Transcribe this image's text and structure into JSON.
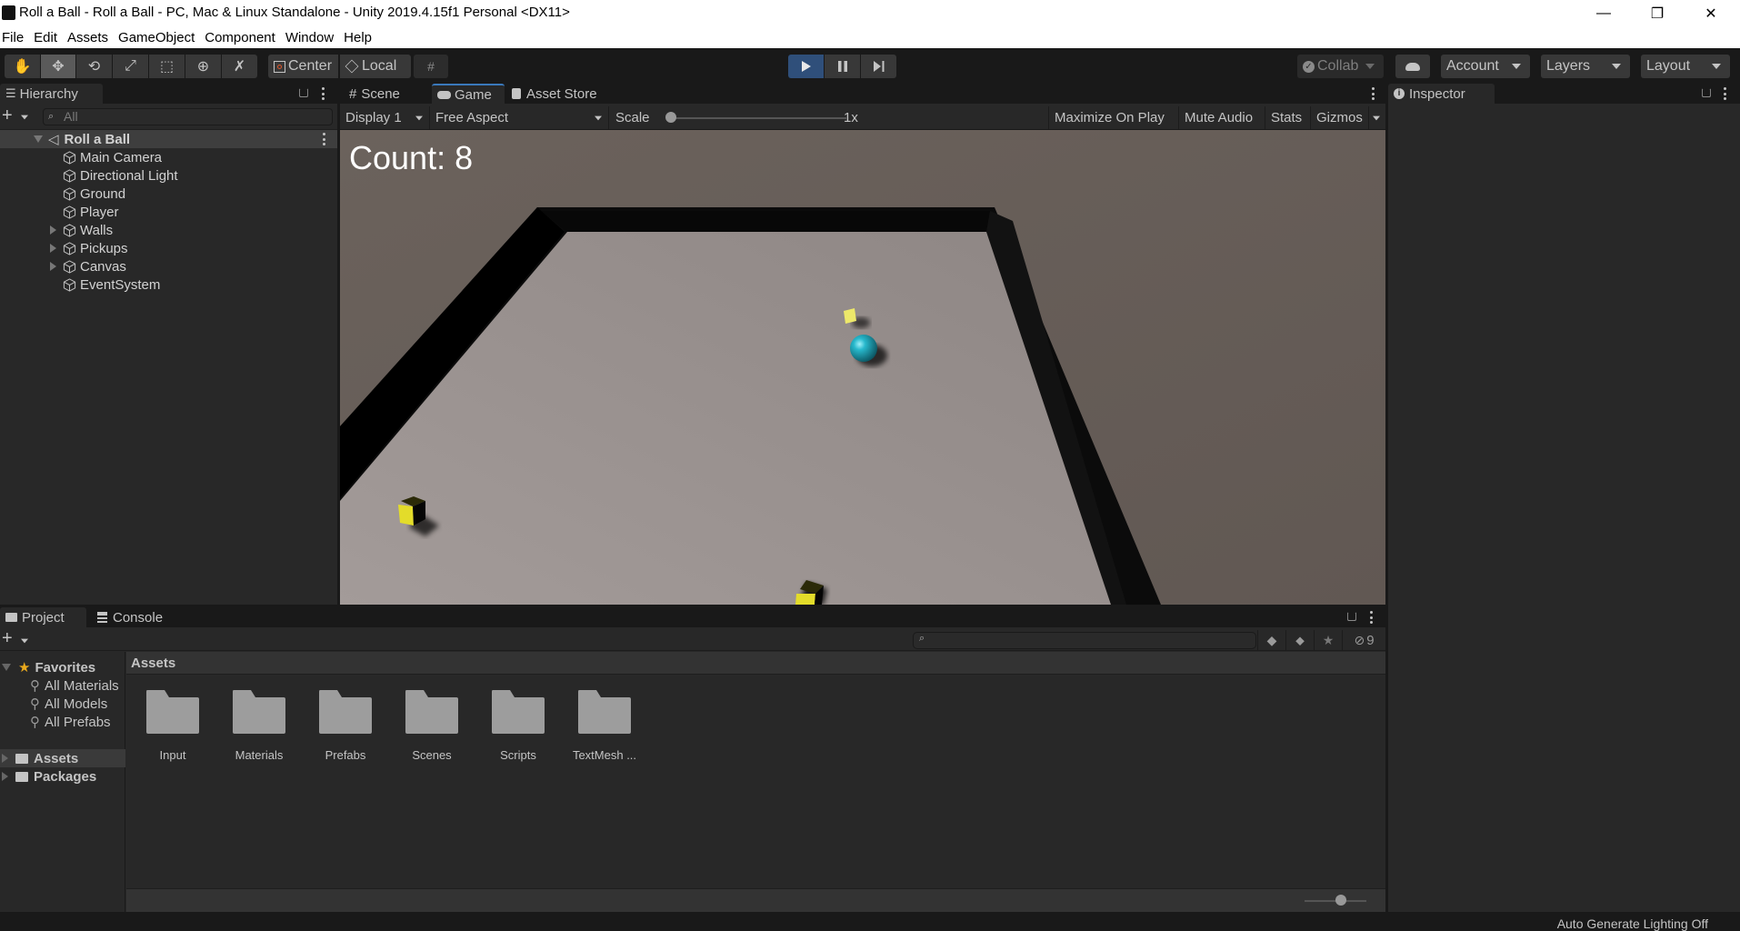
{
  "window": {
    "title": "Roll a Ball - Roll a Ball - PC, Mac & Linux Standalone - Unity 2019.4.15f1 Personal <DX11>",
    "controls": {
      "minimize": "—",
      "maximize": "❐",
      "close": "✕"
    }
  },
  "menubar": [
    "File",
    "Edit",
    "Assets",
    "GameObject",
    "Component",
    "Window",
    "Help"
  ],
  "toolbar": {
    "tools": [
      {
        "name": "hand-tool",
        "icon": "hand-icon",
        "glyph": "✋",
        "active": false
      },
      {
        "name": "move-tool",
        "icon": "move-icon",
        "glyph": "✥",
        "active": true
      },
      {
        "name": "rotate-tool",
        "icon": "rotate-icon",
        "glyph": "⟲",
        "active": false
      },
      {
        "name": "scale-tool",
        "icon": "scale-icon",
        "glyph": "⤢",
        "active": false
      },
      {
        "name": "rect-tool",
        "icon": "rect-icon",
        "glyph": "⬚",
        "active": false
      },
      {
        "name": "transform-tool",
        "icon": "transform-icon",
        "glyph": "⊕",
        "active": false
      },
      {
        "name": "custom-tool",
        "icon": "wrench-icon",
        "glyph": "✗",
        "active": false
      }
    ],
    "pivot_mode": "Center",
    "pivot_rotation": "Local",
    "collab": "Collab",
    "account": "Account",
    "layers": "Layers",
    "layout": "Layout",
    "accent": "#2f4f7a"
  },
  "hierarchy": {
    "tab": "Hierarchy",
    "search_placeholder": "All",
    "scene": "Roll a Ball",
    "items": [
      {
        "label": "Main Camera",
        "expandable": false
      },
      {
        "label": "Directional Light",
        "expandable": false
      },
      {
        "label": "Ground",
        "expandable": false
      },
      {
        "label": "Player",
        "expandable": false
      },
      {
        "label": "Walls",
        "expandable": true
      },
      {
        "label": "Pickups",
        "expandable": true
      },
      {
        "label": "Canvas",
        "expandable": true
      },
      {
        "label": "EventSystem",
        "expandable": false
      }
    ]
  },
  "center": {
    "tabs": [
      {
        "label": "Scene",
        "icon": "grid-icon",
        "selected": false
      },
      {
        "label": "Game",
        "icon": "gamepad-icon",
        "selected": true
      },
      {
        "label": "Asset Store",
        "icon": "bag-icon",
        "selected": false
      }
    ],
    "game_toolbar": {
      "display": "Display 1",
      "aspect": "Free Aspect",
      "scale_label": "Scale",
      "scale_value": "1x",
      "maximize_on_play": "Maximize On Play",
      "mute_audio": "Mute Audio",
      "stats": "Stats",
      "gizmos": "Gizmos"
    },
    "game": {
      "count_text": "Count: 8",
      "colors": {
        "sky": "#686059",
        "ground": "#958d8b",
        "wall": "#0b0b0b",
        "player": "#1fa6b8",
        "pickup": "#e3dc2a"
      }
    }
  },
  "inspector": {
    "tab": "Inspector"
  },
  "bottom": {
    "tabs": [
      {
        "label": "Project",
        "icon": "folder-icon",
        "selected": true
      },
      {
        "label": "Console",
        "icon": "console-icon",
        "selected": false
      }
    ],
    "hidden_count": "9",
    "favorites": {
      "label": "Favorites",
      "items": [
        "All Materials",
        "All Models",
        "All Prefabs"
      ]
    },
    "roots": [
      "Assets",
      "Packages"
    ],
    "breadcrumb": "Assets",
    "folders": [
      "Input",
      "Materials",
      "Prefabs",
      "Scenes",
      "Scripts",
      "TextMesh ..."
    ]
  },
  "statusbar": {
    "text": "Auto Generate Lighting Off"
  }
}
